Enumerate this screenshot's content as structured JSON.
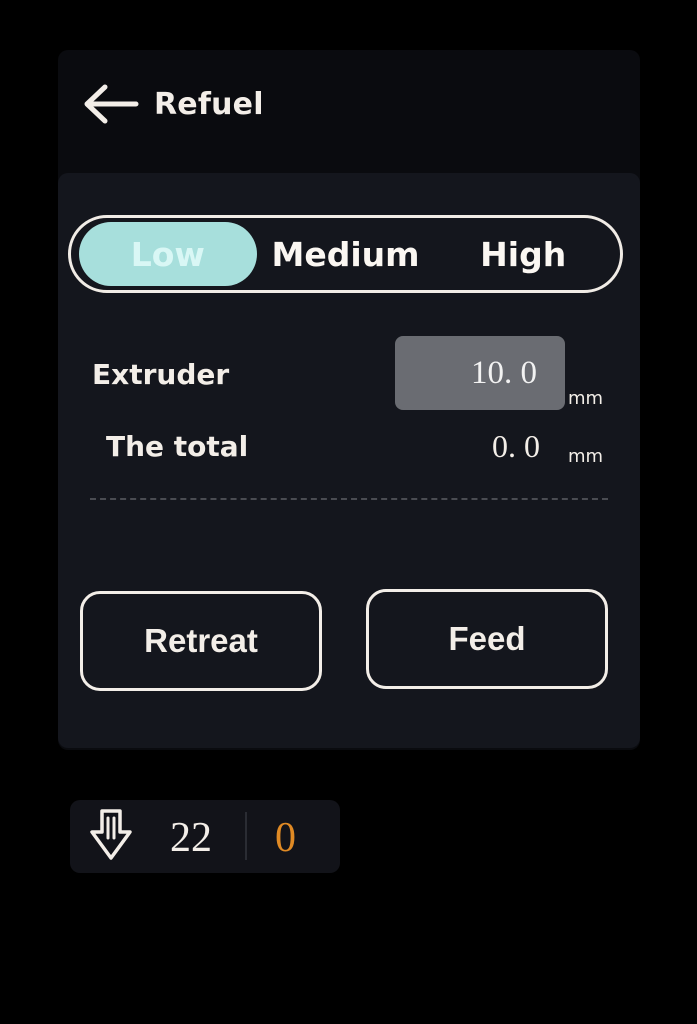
{
  "header": {
    "title": "Refuel"
  },
  "speed": {
    "options": [
      "Low",
      "Medium",
      "High"
    ],
    "selected": "Low"
  },
  "extruder": {
    "label": "Extruder",
    "value": "10. 0",
    "unit": "mm"
  },
  "total": {
    "label": "The total",
    "value": "0. 0",
    "unit": "mm"
  },
  "actions": {
    "retreat_label": "Retreat",
    "feed_label": "Feed"
  },
  "status": {
    "nozzle_temp": "22",
    "target_temp": "0"
  },
  "colors": {
    "accent": "#a7dfdc",
    "target_orange": "#e08a24",
    "panel": "#14161d"
  },
  "icons": {
    "back": "arrow-left-icon",
    "nozzle": "nozzle-icon"
  }
}
